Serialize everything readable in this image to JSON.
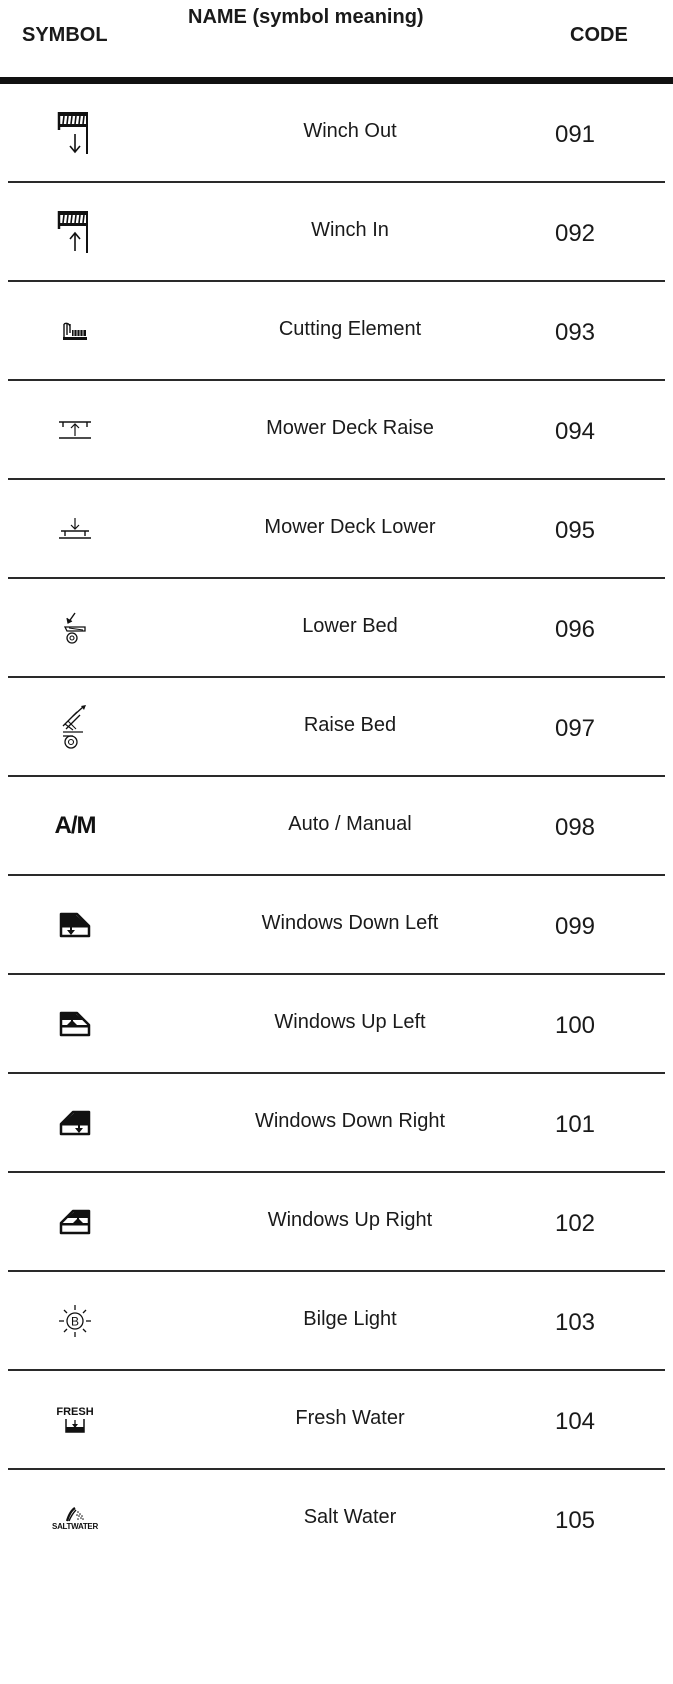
{
  "header": {
    "symbol": "SYMBOL",
    "name": "NAME (symbol meaning)",
    "code": "CODE"
  },
  "rows": [
    {
      "icon": "winch-out-icon",
      "name": "Winch Out",
      "code": "091"
    },
    {
      "icon": "winch-in-icon",
      "name": "Winch In",
      "code": "092"
    },
    {
      "icon": "cutting-element-icon",
      "name": "Cutting Element",
      "code": "093"
    },
    {
      "icon": "mower-deck-raise-icon",
      "name": "Mower Deck Raise",
      "code": "094"
    },
    {
      "icon": "mower-deck-lower-icon",
      "name": "Mower Deck Lower",
      "code": "095"
    },
    {
      "icon": "lower-bed-icon",
      "name": "Lower Bed",
      "code": "096"
    },
    {
      "icon": "raise-bed-icon",
      "name": "Raise Bed",
      "code": "097"
    },
    {
      "icon": "auto-manual-icon",
      "name": "Auto / Manual",
      "code": "098",
      "icon_text": "A/M"
    },
    {
      "icon": "windows-down-left-icon",
      "name": "Windows Down Left",
      "code": "099"
    },
    {
      "icon": "windows-up-left-icon",
      "name": "Windows Up Left",
      "code": "100"
    },
    {
      "icon": "windows-down-right-icon",
      "name": "Windows Down Right",
      "code": "101"
    },
    {
      "icon": "windows-up-right-icon",
      "name": "Windows Up Right",
      "code": "102"
    },
    {
      "icon": "bilge-light-icon",
      "name": "Bilge Light",
      "code": "103",
      "icon_text": "B"
    },
    {
      "icon": "fresh-water-icon",
      "name": "Fresh Water",
      "code": "104",
      "icon_text": "FRESH"
    },
    {
      "icon": "salt-water-icon",
      "name": "Salt Water",
      "code": "105",
      "icon_text": "SALTWATER"
    }
  ]
}
